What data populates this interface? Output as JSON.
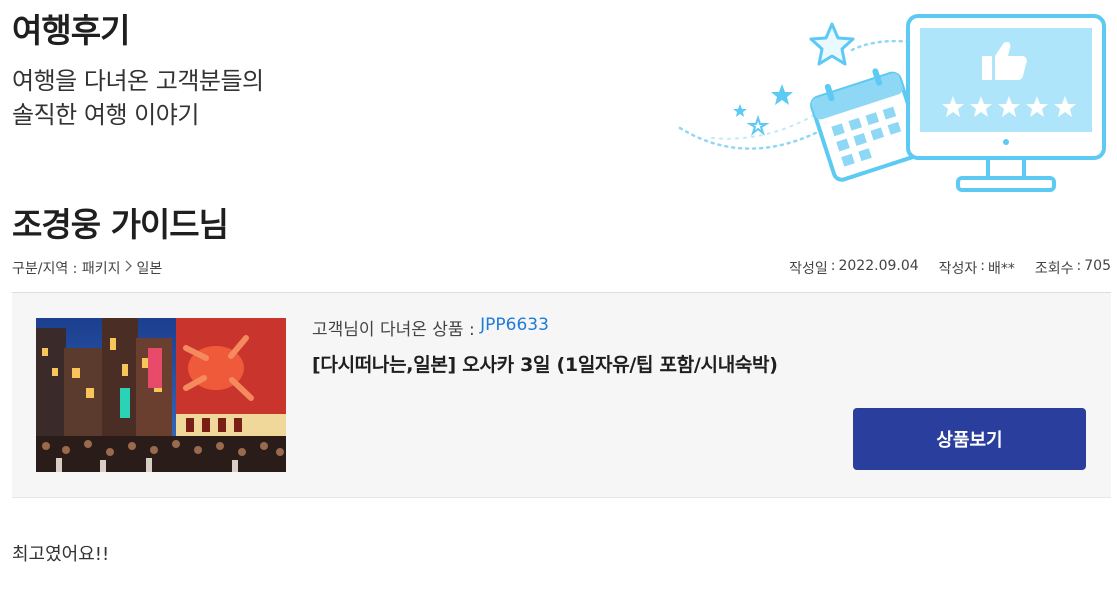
{
  "header": {
    "title": "여행후기",
    "subtitle_line1": "여행을 다녀온 고객분들의",
    "subtitle_line2": "솔직한 여행 이야기"
  },
  "review": {
    "title": "조경웅 가이드님",
    "category_label": "구분/지역 : 패키지",
    "region": "일본",
    "date_label": "작성일",
    "date_value": "2022.09.04",
    "author_label": "작성자",
    "author_value": "배**",
    "views_label": "조회수",
    "views_value": "705",
    "body": "최고였어요!!"
  },
  "product": {
    "code_label": "고객님이 다녀온 상품 :",
    "code": "JPP6633",
    "name": "[다시떠나는,일본] 오사카 3일 (1일자유/팁 포함/시내숙박)",
    "button_label": "상품보기"
  },
  "colors": {
    "accent": "#2a3f9d",
    "link": "#1f7bd8",
    "illustration": "#4fc3f0"
  },
  "icons": {
    "breadcrumb_separator": "chevron-right-icon",
    "illustration": "review-monitor-illustration"
  }
}
